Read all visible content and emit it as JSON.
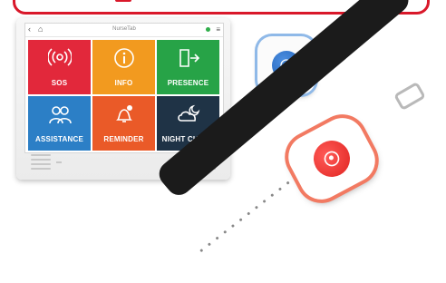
{
  "app": {
    "title": "NurseTab"
  },
  "tiles": [
    {
      "label": "SOS",
      "icon": "broadcast-icon",
      "color": "#e2283b"
    },
    {
      "label": "INFO",
      "icon": "info-icon",
      "color": "#f29a1f"
    },
    {
      "label": "PRESENCE",
      "icon": "door-exit-icon",
      "color": "#27a347"
    },
    {
      "label": "ASSISTANCE",
      "icon": "people-icon",
      "color": "#2c7fc6"
    },
    {
      "label": "REMINDER",
      "icon": "bell-clock-icon",
      "color": "#ea5a28"
    },
    {
      "label": "NIGHT CHECK",
      "icon": "moon-cloud-icon",
      "color": "#1f3346"
    }
  ],
  "colors": {
    "banner_border": "#d9182a",
    "status_dot": "#2fae4a",
    "pendant_button": "#1c5fb8",
    "watch_button": "#e02420"
  }
}
